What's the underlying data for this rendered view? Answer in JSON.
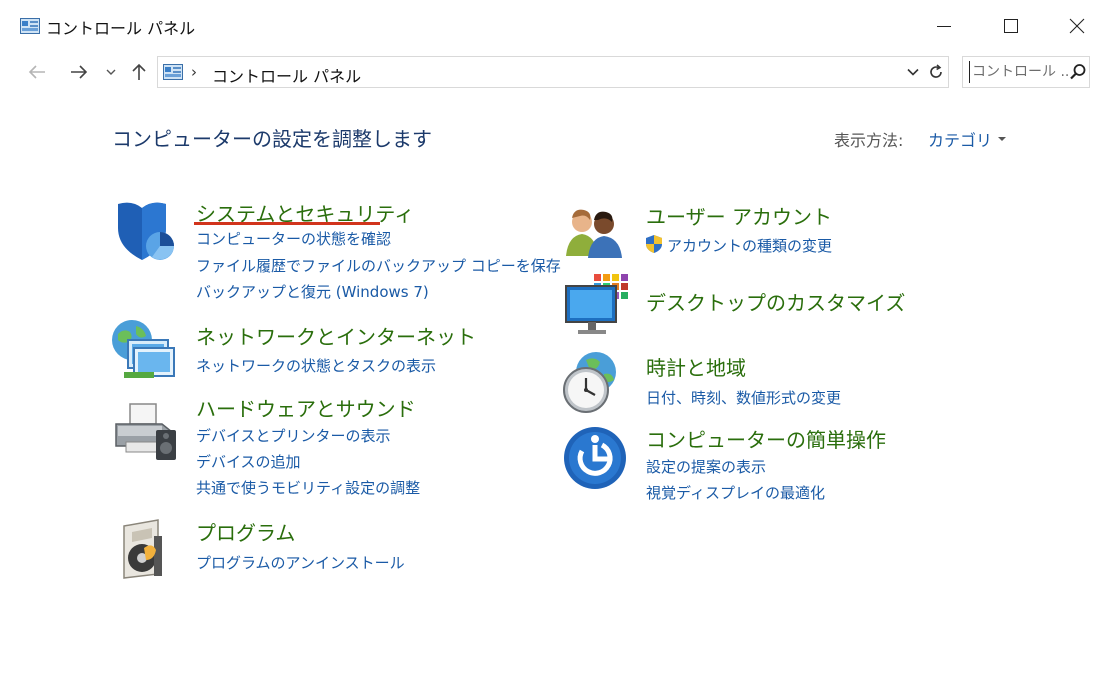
{
  "window": {
    "title": "コントロール パネル"
  },
  "address": {
    "path": "コントロール パネル",
    "separator": "›"
  },
  "search": {
    "placeholder": "コントロール ..."
  },
  "main": {
    "heading": "コンピューターの設定を調整します",
    "view_by_label": "表示方法:",
    "view_by_value": "カテゴリ"
  },
  "categories": {
    "system_security": {
      "title": "システムとセキュリティ",
      "links": [
        "コンピューターの状態を確認",
        "ファイル履歴でファイルのバックアップ コピーを保存",
        "バックアップと復元 (Windows 7)"
      ]
    },
    "network": {
      "title": "ネットワークとインターネット",
      "links": [
        "ネットワークの状態とタスクの表示"
      ]
    },
    "hardware": {
      "title": "ハードウェアとサウンド",
      "links": [
        "デバイスとプリンターの表示",
        "デバイスの追加",
        "共通で使うモビリティ設定の調整"
      ]
    },
    "programs": {
      "title": "プログラム",
      "links": [
        "プログラムのアンインストール"
      ]
    },
    "user_accounts": {
      "title": "ユーザー アカウント",
      "links": [
        "アカウントの種類の変更"
      ]
    },
    "appearance": {
      "title": "デスクトップのカスタマイズ",
      "links": []
    },
    "clock_region": {
      "title": "時計と地域",
      "links": [
        "日付、時刻、数値形式の変更"
      ]
    },
    "ease_of_access": {
      "title": "コンピューターの簡単操作",
      "links": [
        "設定の提案の表示",
        "視覚ディスプレイの最適化"
      ]
    }
  },
  "colors": {
    "category_title": "#2a6e0c",
    "link": "#1a5aa6",
    "highlight_underline": "#d1341c"
  }
}
